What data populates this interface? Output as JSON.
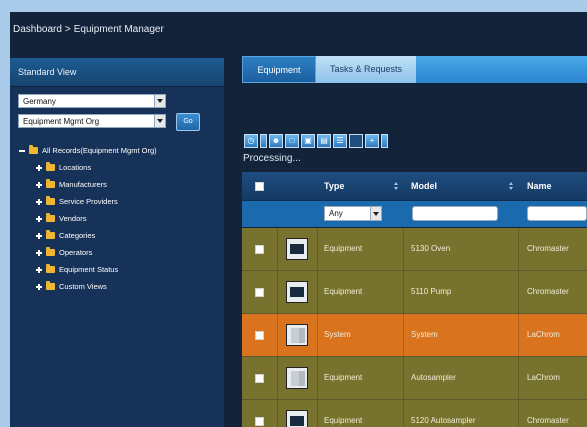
{
  "breadcrumb": {
    "items": [
      "Dashboard",
      "Equipment Manager"
    ],
    "separator": ">"
  },
  "left_panel": {
    "title": "Standard View",
    "country_select": "Germany",
    "org_select": "Equipment Mgmt Org",
    "go_label": "Go",
    "tree": {
      "root": "All Records(Equipment Mgmt Org)",
      "children": [
        "Locations",
        "Manufacturers",
        "Service Providers",
        "Vendors",
        "Categories",
        "Operators",
        "Equipment Status",
        "Custom Views"
      ]
    }
  },
  "tabs": [
    "Equipment",
    "Tasks & Requests"
  ],
  "status": "Processing...",
  "grid": {
    "columns": [
      "Type",
      "Model",
      "Name"
    ],
    "type_filter": "Any",
    "rows": [
      {
        "type": "Equipment",
        "model": "5130 Oven",
        "name": "Chromaster",
        "color": "#77722d",
        "thumb": "dark"
      },
      {
        "type": "Equipment",
        "model": "5110 Pump",
        "name": "Chromaster",
        "color": "#77722d",
        "thumb": "dark"
      },
      {
        "type": "System",
        "model": "System",
        "name": "LaChrom",
        "color": "#d9731e",
        "thumb": "stack"
      },
      {
        "type": "Equipment",
        "model": "Autosampler",
        "name": "LaChrom",
        "color": "#77722d",
        "thumb": "stack"
      },
      {
        "type": "Equipment",
        "model": "5120 Autosampler",
        "name": "Chromaster",
        "color": "#77722d",
        "thumb": "dark"
      }
    ]
  },
  "toolbar": {
    "icons": [
      "clock-icon",
      "add-user-icon",
      "pdf-icon",
      "export-icon",
      "export-alt-icon",
      "barcode-icon",
      "delete-icon",
      "plus-icon"
    ]
  },
  "colors": {
    "app_bg": "#12233a",
    "panel_bg": "#163258",
    "row_olive": "#77722d",
    "row_orange": "#d9731e",
    "accent": "#1c6aae"
  }
}
